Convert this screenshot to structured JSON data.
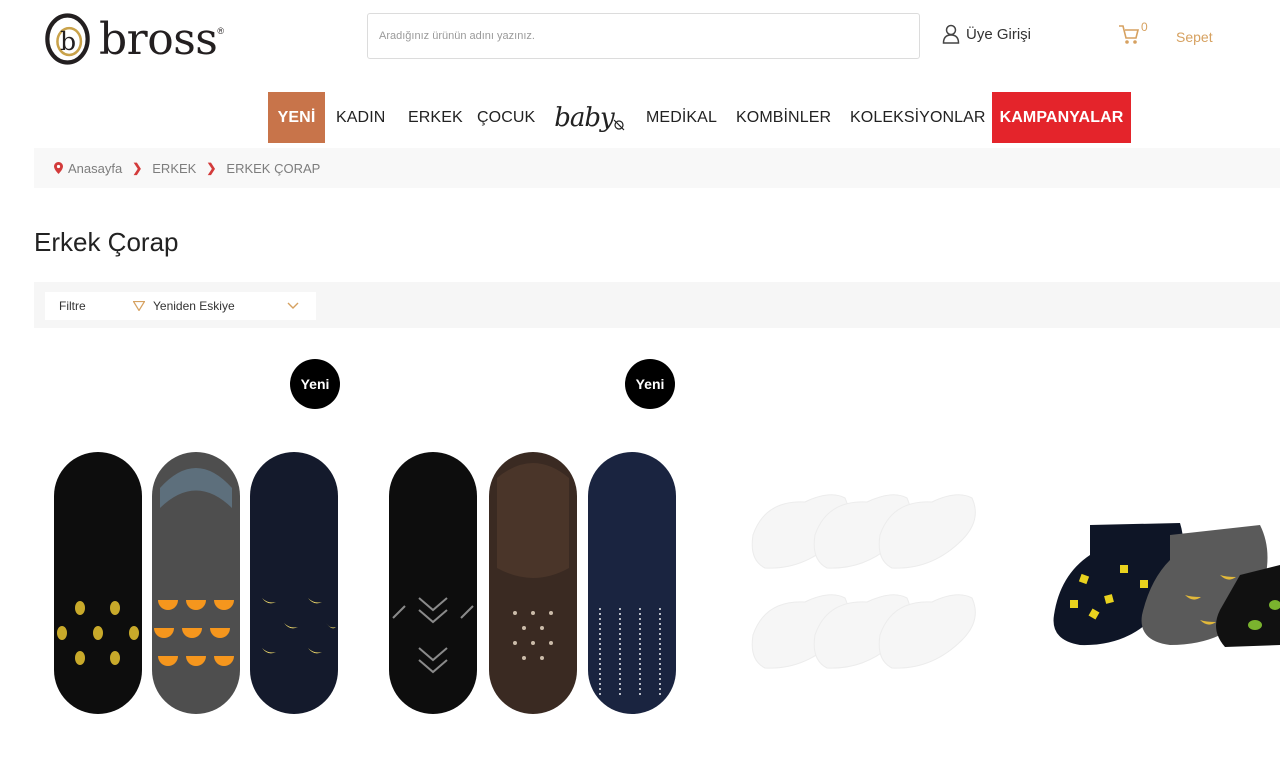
{
  "brand": {
    "name": "bross",
    "registered": "®",
    "logo_letter": "b"
  },
  "search": {
    "placeholder": "Aradığınız ürünün adını yazınız."
  },
  "header": {
    "member_label": "Üye Girişi",
    "cart_count": "0",
    "cart_label": "Sepet"
  },
  "nav": {
    "items": [
      {
        "label": "YENİ"
      },
      {
        "label": "KADIN"
      },
      {
        "label": "ERKEK"
      },
      {
        "label": "ÇOCUK"
      },
      {
        "label": "baby"
      },
      {
        "label": "MEDİKAL"
      },
      {
        "label": "KOMBİNLER"
      },
      {
        "label": "KOLEKSİYONLAR"
      },
      {
        "label": "KAMPANYALAR"
      }
    ],
    "colors": {
      "new": "#c8744a",
      "campaign": "#e4242b"
    }
  },
  "breadcrumb": {
    "items": [
      "Anasayfa",
      "ERKEK",
      "ERKEK ÇORAP"
    ]
  },
  "page": {
    "title": "Erkek Çorap"
  },
  "filter": {
    "label": "Filtre",
    "sort_selected": "Yeniden Eskiye"
  },
  "products": {
    "badge_label": "Yeni",
    "items": [
      {
        "image": "no-show-socks-fruit-pattern-3-pack",
        "badge": true
      },
      {
        "image": "no-show-socks-geometric-pattern-3-pack",
        "badge": true
      },
      {
        "image": "white-ankle-socks-6-pack",
        "badge": false
      },
      {
        "image": "patterned-ankle-socks-fruit-3-pack",
        "badge": false
      }
    ]
  },
  "colors": {
    "accent": "#d6a160",
    "breadcrumb_sep": "#d33b3b"
  }
}
